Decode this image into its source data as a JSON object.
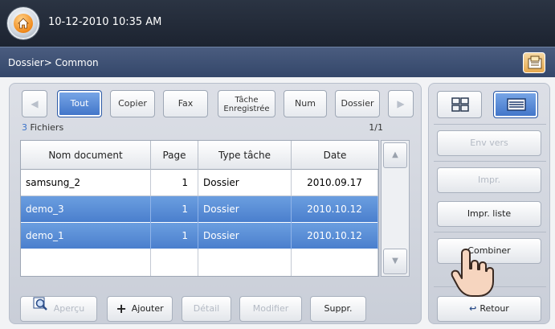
{
  "header": {
    "datetime": "10-12-2010 10:35 AM"
  },
  "path": {
    "text": "Dossier> Common"
  },
  "filters": {
    "prev": "◀",
    "next": "▶",
    "items": [
      {
        "label": "Tout",
        "active": true
      },
      {
        "label": "Copier"
      },
      {
        "label": "Fax"
      },
      {
        "label_line1": "Tâche",
        "label_line2": "Enregistrée"
      },
      {
        "label": "Num"
      },
      {
        "label": "Dossier"
      }
    ]
  },
  "list": {
    "count": "3",
    "count_label": "Fichiers",
    "page_indicator": "1/1",
    "columns": [
      "Nom document",
      "Page",
      "Type tâche",
      "Date"
    ],
    "rows": [
      {
        "name": "samsung_2",
        "page": "1",
        "type": "Dossier",
        "date": "2010.09.17",
        "selected": false
      },
      {
        "name": "demo_3",
        "page": "1",
        "type": "Dossier",
        "date": "2010.10.12",
        "selected": true
      },
      {
        "name": "demo_1",
        "page": "1",
        "type": "Dossier",
        "date": "2010.10.12",
        "selected": true
      }
    ],
    "scroll_up": "▲",
    "scroll_down": "▼"
  },
  "bottom": {
    "preview": "Aperçu",
    "add": "Ajouter",
    "detail": "Détail",
    "modify": "Modifier",
    "delete": "Suppr."
  },
  "side": {
    "send_to": "Env vers",
    "print": "Impr.",
    "print_list": "Impr. liste",
    "combine": "Combiner",
    "back": "Retour"
  },
  "icons": [
    "home-icon",
    "document-settings-icon",
    "grid-view-icon",
    "list-view-icon",
    "magnifier-icon",
    "plus-icon",
    "back-arrow-icon",
    "hand-pointer-icon"
  ],
  "colors": {
    "accent": "#4a7fcd",
    "header": "#1c2330",
    "pathbar": "#3d5073"
  }
}
